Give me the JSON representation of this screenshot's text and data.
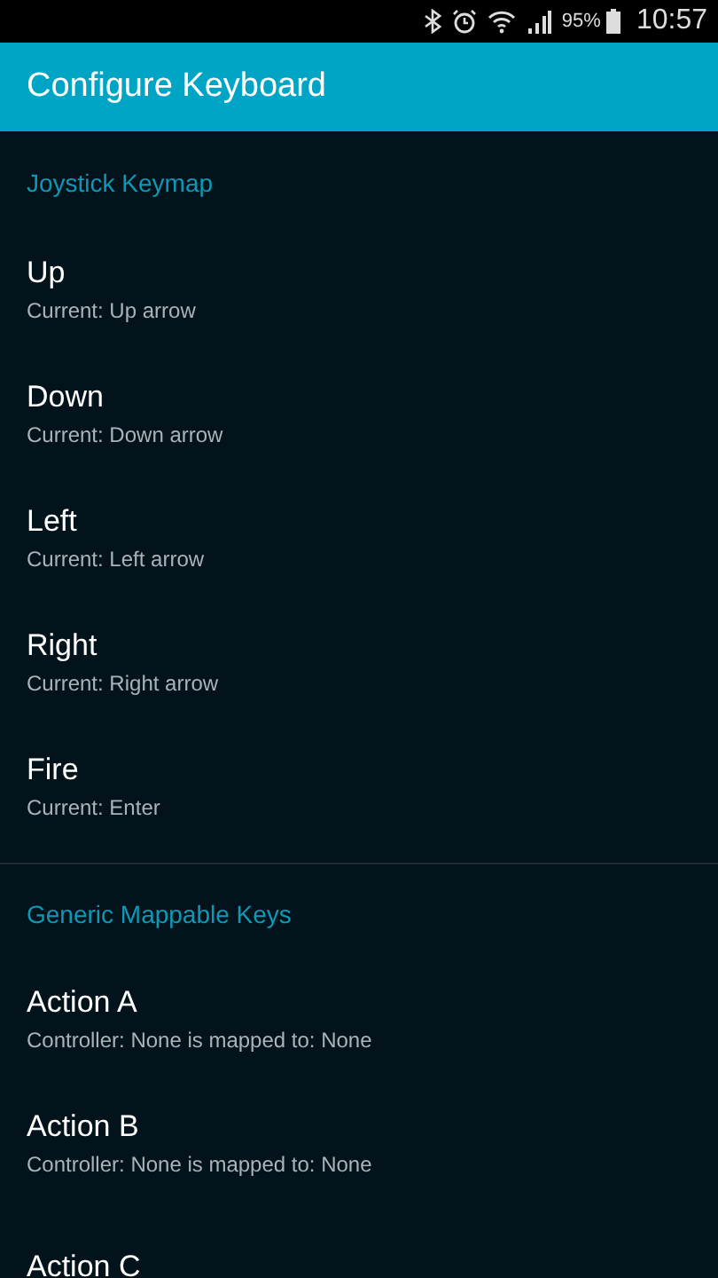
{
  "status_bar": {
    "battery_percent": "95%",
    "time": "10:57"
  },
  "toolbar": {
    "title": "Configure Keyboard"
  },
  "sections": [
    {
      "title": "Joystick Keymap",
      "items": [
        {
          "title": "Up",
          "summary": "Current: Up arrow"
        },
        {
          "title": "Down",
          "summary": "Current: Down arrow"
        },
        {
          "title": "Left",
          "summary": "Current: Left arrow"
        },
        {
          "title": "Right",
          "summary": "Current: Right arrow"
        },
        {
          "title": "Fire",
          "summary": "Current: Enter"
        }
      ]
    },
    {
      "title": "Generic Mappable Keys",
      "items": [
        {
          "title": "Action A",
          "summary": "Controller: None is mapped to: None"
        },
        {
          "title": "Action B",
          "summary": "Controller: None is mapped to: None"
        },
        {
          "title": "Action C"
        }
      ]
    }
  ]
}
